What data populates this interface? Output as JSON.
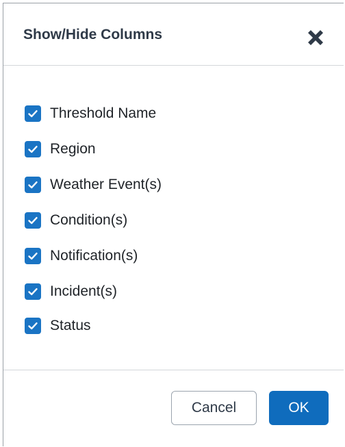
{
  "dialog": {
    "title": "Show/Hide Columns",
    "close_icon": "close-icon"
  },
  "columns": [
    {
      "label": "Threshold Name",
      "checked": true
    },
    {
      "label": "Region",
      "checked": true
    },
    {
      "label": "Weather Event(s)",
      "checked": true
    },
    {
      "label": "Condition(s)",
      "checked": true
    },
    {
      "label": "Notification(s)",
      "checked": true
    },
    {
      "label": "Incident(s)",
      "checked": true
    },
    {
      "label": "Status",
      "checked": true
    }
  ],
  "footer": {
    "cancel_label": "Cancel",
    "ok_label": "OK"
  },
  "colors": {
    "checkbox": "#1a74c4",
    "primary_button": "#0f6cbd",
    "title_text": "#2f3a48"
  }
}
